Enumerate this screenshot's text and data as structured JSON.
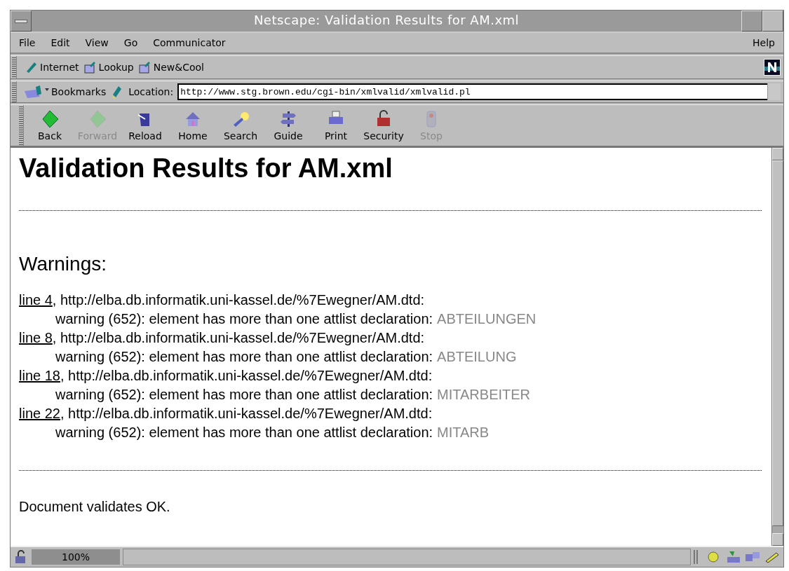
{
  "window": {
    "title": "Netscape: Validation Results for AM.xml"
  },
  "menu": {
    "items": [
      "File",
      "Edit",
      "View",
      "Go",
      "Communicator"
    ],
    "help": "Help"
  },
  "personal_toolbar": {
    "items": [
      "Internet",
      "Lookup",
      "New&Cool"
    ]
  },
  "location_bar": {
    "bookmarks": "Bookmarks",
    "label": "Location:",
    "value": "http://www.stg.brown.edu/cgi-bin/xmlvalid/xmlvalid.pl"
  },
  "navigation": [
    {
      "label": "Back",
      "disabled": false
    },
    {
      "label": "Forward",
      "disabled": true
    },
    {
      "label": "Reload",
      "disabled": false
    },
    {
      "label": "Home",
      "disabled": false
    },
    {
      "label": "Search",
      "disabled": false
    },
    {
      "label": "Guide",
      "disabled": false
    },
    {
      "label": "Print",
      "disabled": false
    },
    {
      "label": "Security",
      "disabled": false
    },
    {
      "label": "Stop",
      "disabled": true
    }
  ],
  "page": {
    "heading": "Validation Results for AM.xml",
    "warnings_heading": "Warnings:",
    "warnings": [
      {
        "link": "line 4",
        "source": ", http://elba.db.informatik.uni-kassel.de/%7Ewegner/AM.dtd:",
        "message": "warning (652): element has more than one attlist declaration:",
        "element": "ABTEILUNGEN"
      },
      {
        "link": "line 8",
        "source": ", http://elba.db.informatik.uni-kassel.de/%7Ewegner/AM.dtd:",
        "message": "warning (652): element has more than one attlist declaration:",
        "element": "ABTEILUNG"
      },
      {
        "link": "line 18",
        "source": ", http://elba.db.informatik.uni-kassel.de/%7Ewegner/AM.dtd:",
        "message": "warning (652): element has more than one attlist declaration:",
        "element": "MITARBEITER"
      },
      {
        "link": "line 22",
        "source": ", http://elba.db.informatik.uni-kassel.de/%7Ewegner/AM.dtd:",
        "message": "warning (652): element has more than one attlist declaration:",
        "element": "MITARB"
      }
    ],
    "result": "Document validates OK."
  },
  "status_bar": {
    "progress": "100%"
  }
}
